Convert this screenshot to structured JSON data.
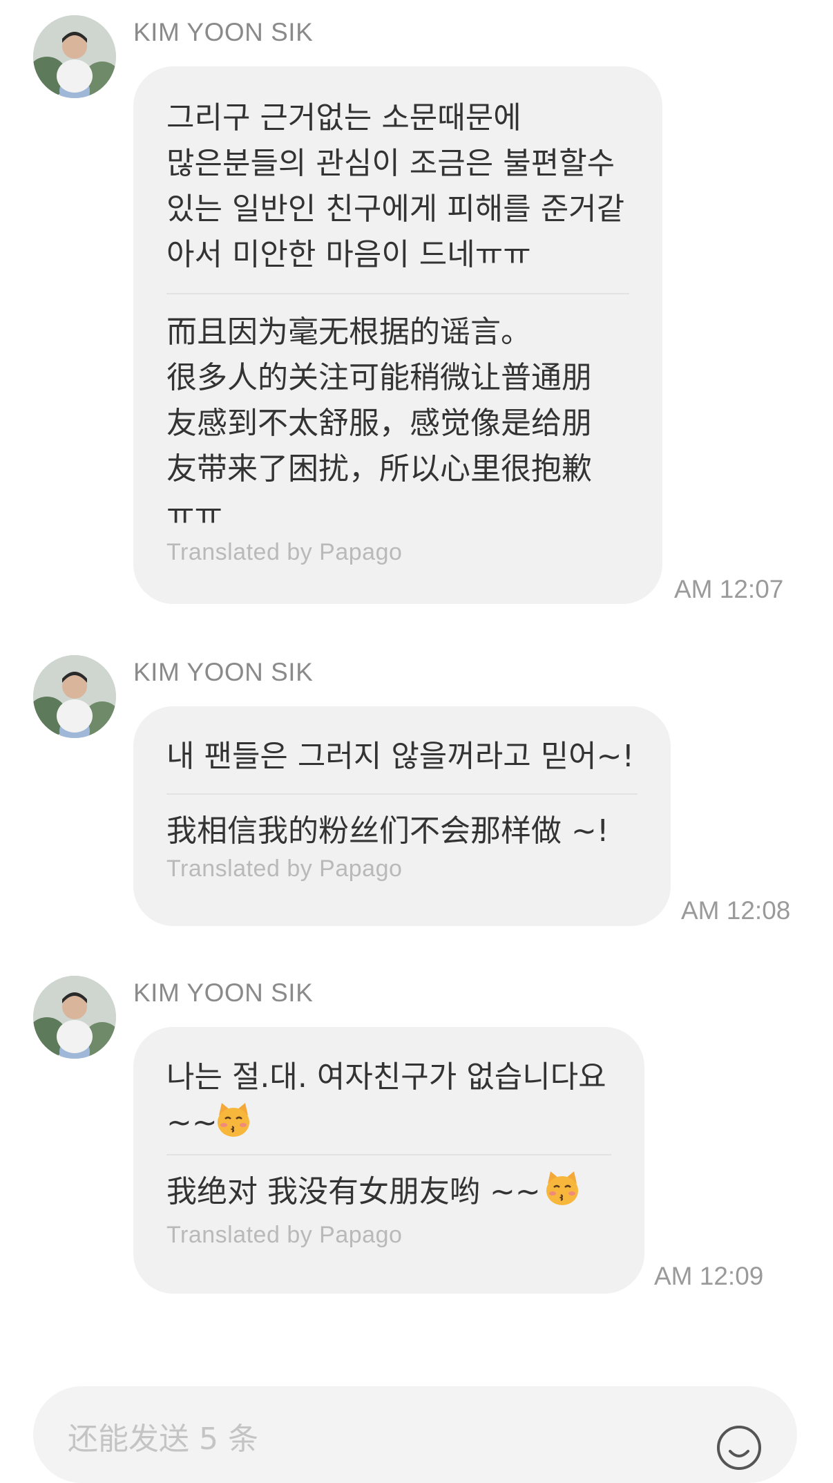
{
  "messages": [
    {
      "sender": "KIM YOON SIK",
      "original": "그리구 근거없는 소문때문에\n많은분들의 관심이 조금은 불편할수\n있는 일반인 친구에게 피해를 준거같\n아서 미안한 마음이 드네ㅠㅠ",
      "translation": "而且因为毫无根据的谣言。\n很多人的关注可能稍微让普通朋\n友感到不太舒服，感觉像是给朋\n友带来了困扰，所以心里很抱歉\nㅠㅠ",
      "translated_by": "Translated by Papago",
      "time": "AM 12:07"
    },
    {
      "sender": "KIM YOON SIK",
      "original": "내 팬들은 그러지 않을꺼라고 믿어~!",
      "translation": "我相信我的粉丝们不会那样做 ~!",
      "translated_by": "Translated by Papago",
      "time": "AM 12:08"
    },
    {
      "sender": "KIM YOON SIK",
      "original": "나는 절.대. 여자친구가 없습니다요\n~~",
      "translation": "我绝对 我没有女朋友哟 ~~",
      "translated_by": "Translated by Papago",
      "time": "AM 12:09",
      "emoji": "kissing-cat-emoji"
    }
  ],
  "input": {
    "placeholder": "还能发送 5 条"
  },
  "colors": {
    "bubble": "#f1f1f1",
    "sender": "#8a8a8a",
    "text": "#333333",
    "translated_label": "#b9b9b9",
    "timestamp": "#9a9a9a"
  }
}
